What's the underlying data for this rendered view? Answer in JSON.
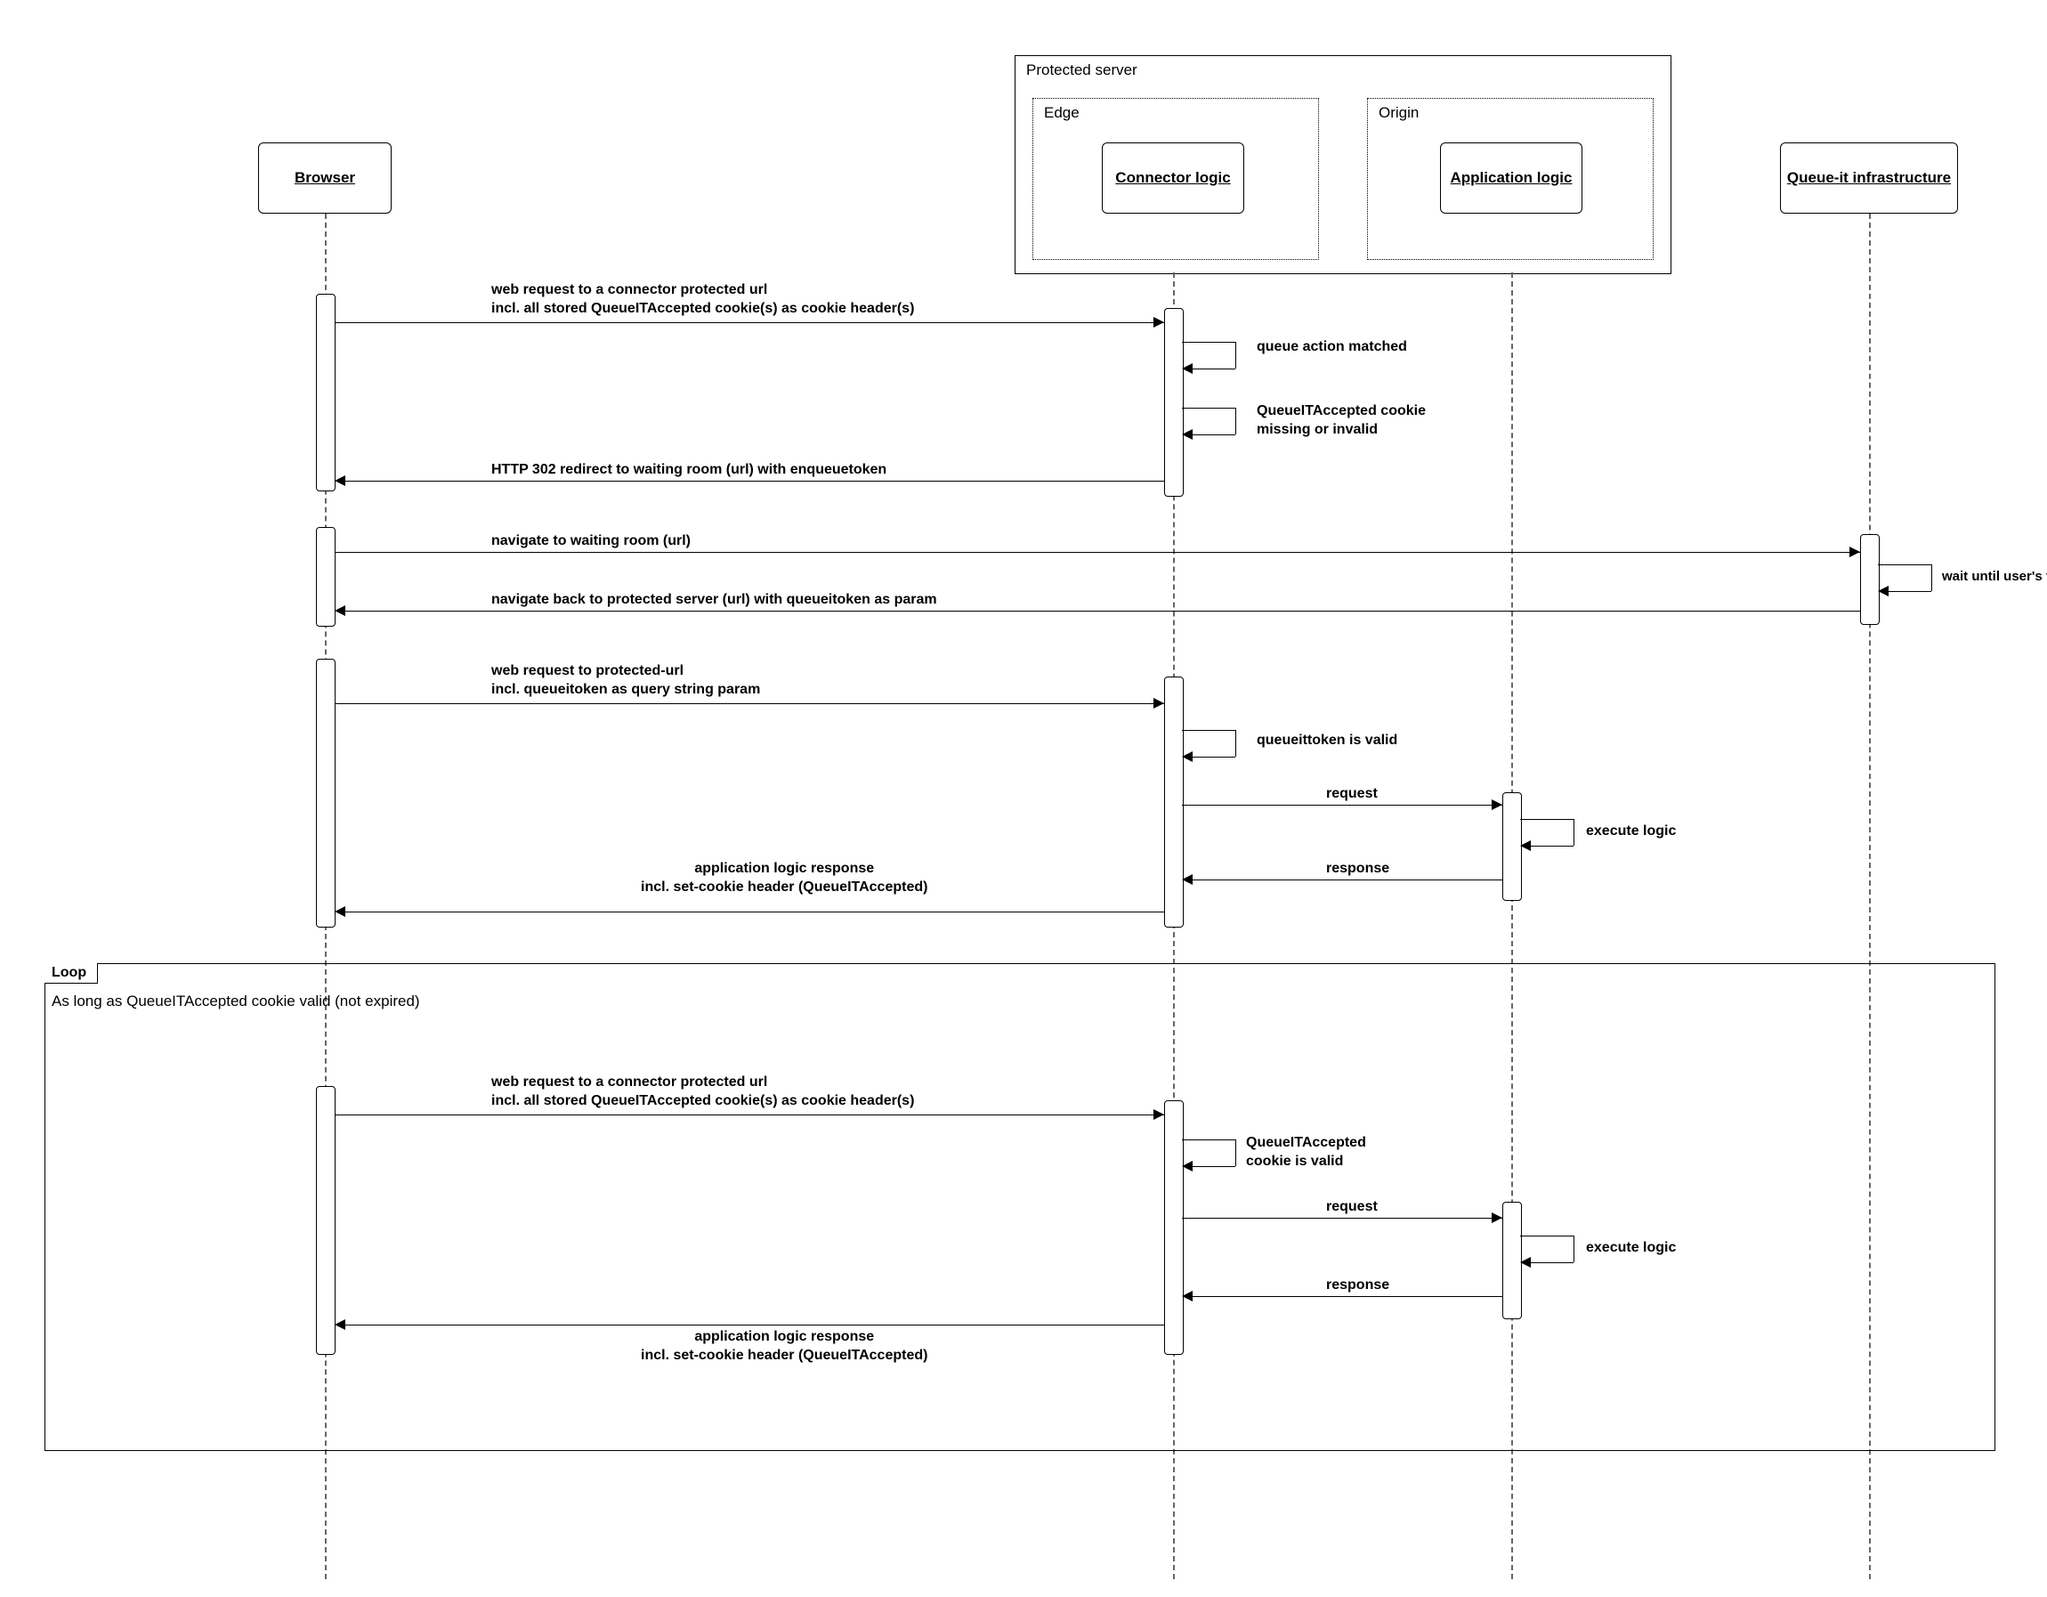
{
  "participants": {
    "browser": "Browser",
    "connector": "Connector\nlogic",
    "application": "Application\nlogic",
    "queueit": "Queue-it\ninfrastructure"
  },
  "containers": {
    "protected_server": "Protected server",
    "edge": "Edge",
    "origin": "Origin"
  },
  "messages": {
    "m1": "web request to a connector protected url\nincl. all stored QueueITAccepted cookie(s) as cookie header(s)",
    "self1": "queue action matched",
    "self2": "QueueITAccepted cookie\nmissing or invalid",
    "m2": "HTTP 302 redirect to waiting room (url) with enqueuetoken",
    "m3": "navigate to waiting room (url)",
    "self3": "wait until user's turn",
    "m4": "navigate back to protected server (url) with queueitoken as param",
    "m5": "web request to protected-url\nincl. queueitoken as query string param",
    "self4": "queueittoken is valid",
    "m6": "request",
    "self5": "execute logic",
    "m7": "response",
    "m8": "application logic response\nincl. set-cookie header (QueueITAccepted)",
    "loop_m1": "web request to a connector protected url\nincl. all stored QueueITAccepted cookie(s) as cookie header(s)",
    "loop_self1": "QueueITAccepted\ncookie is valid",
    "loop_m2": "request",
    "loop_self2": "execute logic",
    "loop_m3": "response",
    "loop_m4": "application logic response\nincl. set-cookie header (QueueITAccepted)"
  },
  "loop": {
    "tag": "Loop",
    "note": "As long as\nQueueITAccepted\ncookie valid (not expired)"
  }
}
